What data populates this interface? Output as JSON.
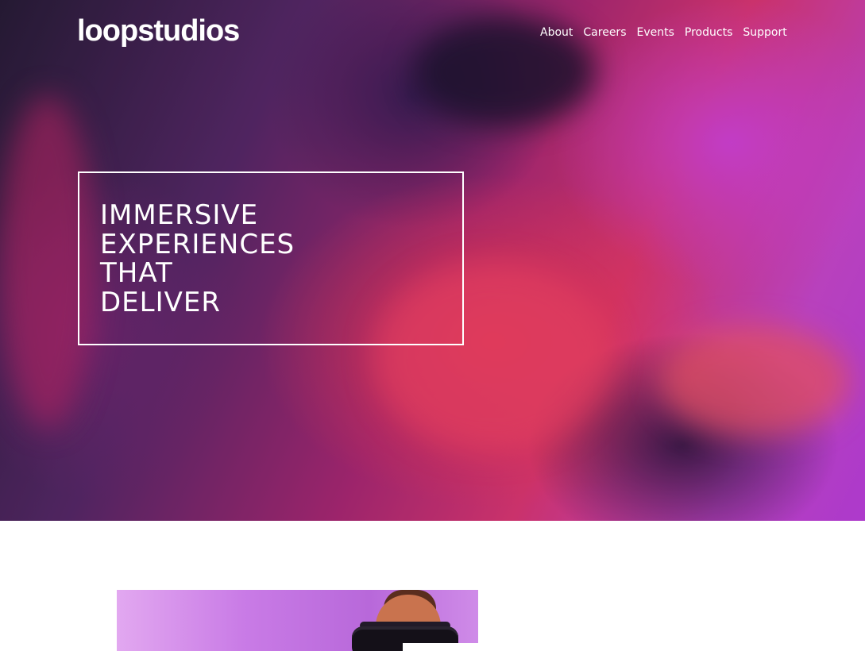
{
  "header": {
    "logo": "loopstudios",
    "nav": [
      {
        "label": "About"
      },
      {
        "label": "Careers"
      },
      {
        "label": "Events"
      },
      {
        "label": "Products"
      },
      {
        "label": "Support"
      }
    ]
  },
  "hero": {
    "headline_lines": [
      "IMMERSIVE",
      "EXPERIENCES",
      "THAT",
      "DELIVER"
    ]
  },
  "colors": {
    "text": "#ffffff",
    "accent_pink": "#e6397a",
    "accent_violet": "#c542e8",
    "dark": "#2a1d3a"
  }
}
